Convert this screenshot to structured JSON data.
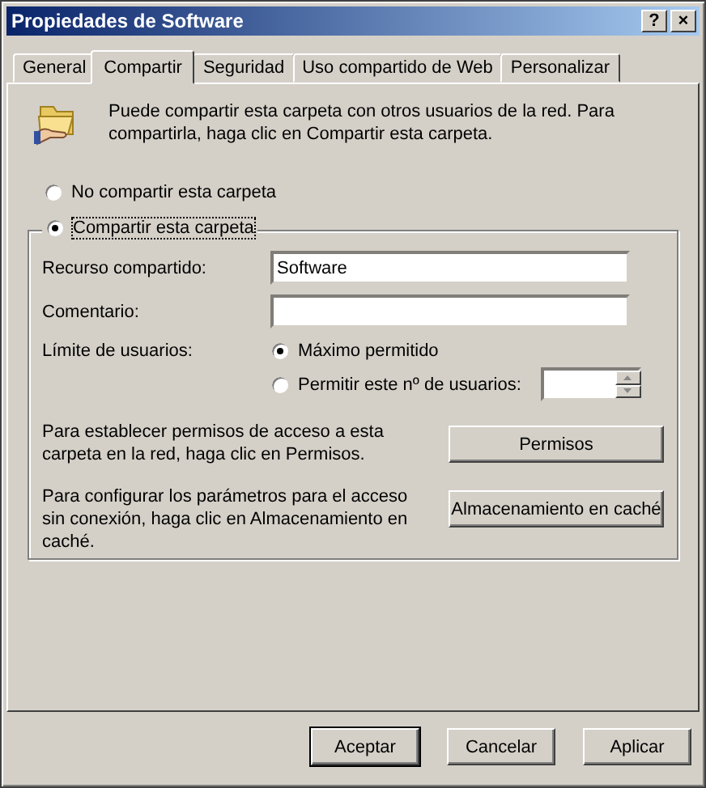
{
  "window": {
    "title": "Propiedades de Software",
    "help_button": "?",
    "close_button": "×"
  },
  "tabs": [
    {
      "label": "General",
      "selected": false
    },
    {
      "label": "Compartir",
      "selected": true
    },
    {
      "label": "Seguridad",
      "selected": false
    },
    {
      "label": "Uso compartido de Web",
      "selected": false
    },
    {
      "label": "Personalizar",
      "selected": false
    }
  ],
  "intro": "Puede compartir esta carpeta con otros usuarios de la red. Para compartirla, haga clic en Compartir esta carpeta.",
  "share_options": [
    {
      "label": "No compartir esta carpeta",
      "selected": false,
      "focused": false
    },
    {
      "label": "Compartir esta carpeta",
      "selected": true,
      "focused": true
    }
  ],
  "fields": [
    {
      "label": "Recurso compartido:",
      "value": "Software"
    },
    {
      "label": "Comentario:"
    }
  ],
  "user_limit": {
    "label": "Límite de usuarios:",
    "options": [
      {
        "kind": "plain",
        "label": "Máximo permitido",
        "selected": true
      },
      {
        "kind": "count",
        "label": "Permitir este nº de usuarios:",
        "selected": false
      }
    ]
  },
  "actions": [
    {
      "description": "Para establecer permisos de acceso a esta carpeta en la red, haga clic en Permisos.",
      "button": "Permisos"
    },
    {
      "description": "Para configurar los parámetros para el acceso sin conexión, haga clic en Almacenamiento en caché.",
      "button": "Almacenamiento en caché"
    }
  ],
  "buttons": [
    {
      "label": "Aceptar",
      "default": true
    },
    {
      "label": "Cancelar",
      "default": false
    },
    {
      "label": "Aplicar",
      "default": false
    }
  ]
}
